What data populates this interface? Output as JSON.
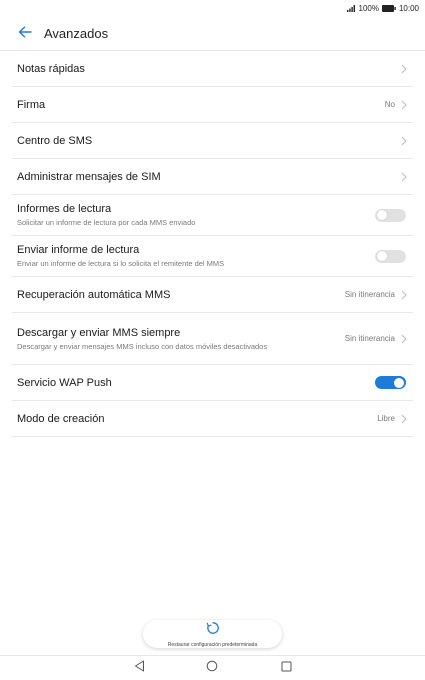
{
  "status_bar": {
    "battery": "100%",
    "time": "10:00",
    "icons": [
      "signal-icon",
      "battery-icon"
    ]
  },
  "header": {
    "title": "Avanzados",
    "back_icon": "arrow-left-icon"
  },
  "accent_color": "#1e7bd9",
  "settings": [
    {
      "title": "Notas rápidas"
    },
    {
      "title": "Firma",
      "value": "No"
    },
    {
      "title": "Centro de SMS"
    },
    {
      "title": "Administrar mensajes de SIM"
    },
    {
      "title": "Informes de lectura",
      "subtitle": "Solicitar un informe de lectura por cada MMS enviado",
      "toggle": false
    },
    {
      "title": "Enviar informe de lectura",
      "subtitle": "Enviar un informe de lectura si lo solicita el remitente del MMS",
      "toggle": false
    },
    {
      "title": "Recuperación automática MMS",
      "value": "Sin itinerancia"
    },
    {
      "title": "Descargar y enviar MMS siempre",
      "subtitle": "Descargar y enviar mensajes MMS incluso con datos móviles desactivados",
      "value": "Sin itinerancia"
    },
    {
      "title": "Servicio WAP Push",
      "toggle": true
    },
    {
      "title": "Modo de creación",
      "value": "Libre"
    }
  ],
  "restore": {
    "label": "Restaurar configuración predeterminada",
    "icon": "restore-icon"
  },
  "nav": {
    "icons": [
      "back-triangle-icon",
      "home-circle-icon",
      "recents-square-icon"
    ]
  }
}
